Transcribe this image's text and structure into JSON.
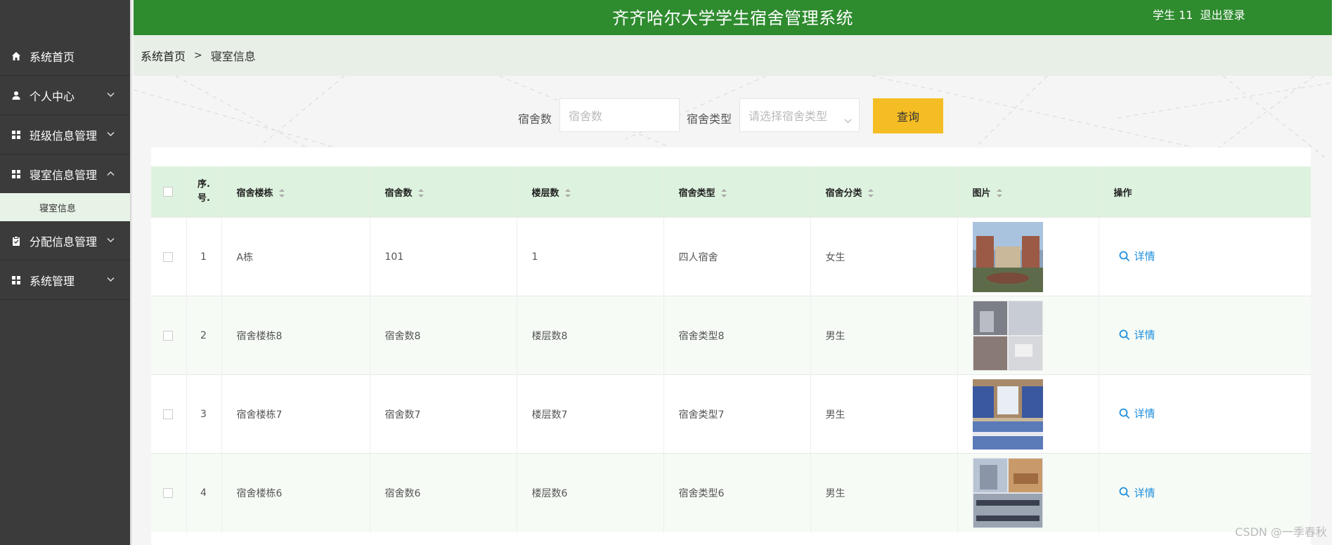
{
  "app": {
    "title": "齐齐哈尔大学学生宿舍管理系统",
    "user": "学生 11",
    "logout": "退出登录"
  },
  "sidebar": {
    "items": [
      {
        "label": "系统首页",
        "icon": "home-icon",
        "has_children": false
      },
      {
        "label": "个人中心",
        "icon": "user-icon",
        "has_children": true,
        "expanded": false
      },
      {
        "label": "班级信息管理",
        "icon": "grid-icon",
        "has_children": true,
        "expanded": false
      },
      {
        "label": "寝室信息管理",
        "icon": "grid-icon",
        "has_children": true,
        "expanded": true
      },
      {
        "label": "分配信息管理",
        "icon": "clipboard-icon",
        "has_children": true,
        "expanded": false
      },
      {
        "label": "系统管理",
        "icon": "grid-icon",
        "has_children": true,
        "expanded": false
      }
    ],
    "subitem": "寝室信息"
  },
  "breadcrumb": {
    "home": "系统首页",
    "separator": ">",
    "current": "寝室信息"
  },
  "search": {
    "field1_label": "宿舍数",
    "field1_placeholder": "宿舍数",
    "field2_label": "宿舍类型",
    "field2_placeholder": "请选择宿舍类型",
    "button": "查询"
  },
  "table": {
    "columns": [
      "序.号.",
      "宿舍楼栋",
      "宿舍数",
      "楼层数",
      "宿舍类型",
      "宿舍分类",
      "图片",
      "操作"
    ],
    "rows": [
      {
        "no": "1",
        "building": "A栋",
        "rooms": "101",
        "floors": "1",
        "type": "四人宿舍",
        "category": "女生",
        "action": "详情"
      },
      {
        "no": "2",
        "building": "宿舍楼栋8",
        "rooms": "宿舍数8",
        "floors": "楼层数8",
        "type": "宿舍类型8",
        "category": "男生",
        "action": "详情"
      },
      {
        "no": "3",
        "building": "宿舍楼栋7",
        "rooms": "宿舍数7",
        "floors": "楼层数7",
        "type": "宿舍类型7",
        "category": "男生",
        "action": "详情"
      },
      {
        "no": "4",
        "building": "宿舍楼栋6",
        "rooms": "宿舍数6",
        "floors": "楼层数6",
        "type": "宿舍类型6",
        "category": "男生",
        "action": "详情"
      }
    ]
  },
  "watermark": "CSDN @一季春秋",
  "colors": {
    "header": "#2e8b2e",
    "sidebar": "#3b3b3b",
    "table_header": "#def3df",
    "query_button": "#f5bd24",
    "link": "#1f8fde"
  }
}
